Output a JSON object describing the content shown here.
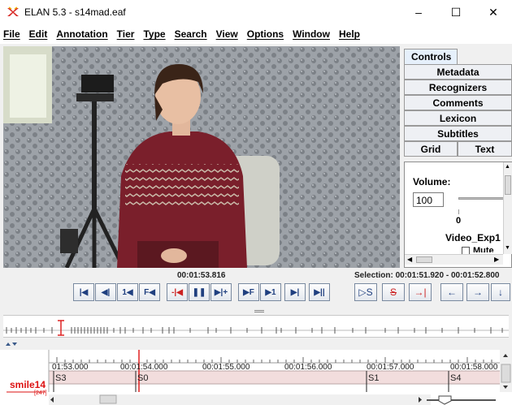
{
  "window": {
    "title": "ELAN 5.3 - s14mad.eaf",
    "minimize_label": "–",
    "maximize_label": "☐",
    "close_label": "✕"
  },
  "menu": [
    "File",
    "Edit",
    "Annotation",
    "Tier",
    "Type",
    "Search",
    "View",
    "Options",
    "Window",
    "Help"
  ],
  "side_tabs": {
    "controls": "Controls",
    "metadata": "Metadata",
    "recognizers": "Recognizers",
    "comments": "Comments",
    "lexicon": "Lexicon",
    "subtitles": "Subtitles",
    "grid": "Grid",
    "text": "Text"
  },
  "controls_panel": {
    "volume_label": "Volume:",
    "volume_value": "100",
    "slider_zero": "0",
    "video_label": "Video_Exp1",
    "mute_label": "Mute"
  },
  "playback": {
    "current_time": "00:01:53.816",
    "selection": "Selection: 00:01:51.920 - 00:01:52.800",
    "buttons": {
      "go_begin": "|◀",
      "prev_frame_set": "◀|",
      "back_one_sec": "1◀",
      "frame_back": "F◀",
      "prev_pixel": "-|◀",
      "pause": "❚❚",
      "next_pixel": "▶|+",
      "frame_forward": "▶F",
      "forward_one_sec": "▶1",
      "next_frame_set": "▶|",
      "go_end": "▶||",
      "play_selection": "▷S",
      "clear_selection": "S",
      "selection_mode": "→|",
      "prev_annotation": "←",
      "next_annotation": "→",
      "down_tier": "↓"
    }
  },
  "timeline": {
    "ruler": [
      "01:53.000",
      "00:01:54.000",
      "00:01:55.000",
      "00:01:56.000",
      "00:01:57.000",
      "00:01:58.000"
    ],
    "tier_name": "smile14",
    "tier_count": "[247]",
    "annotations": [
      "S3",
      "S0",
      "S1",
      "S4"
    ]
  }
}
